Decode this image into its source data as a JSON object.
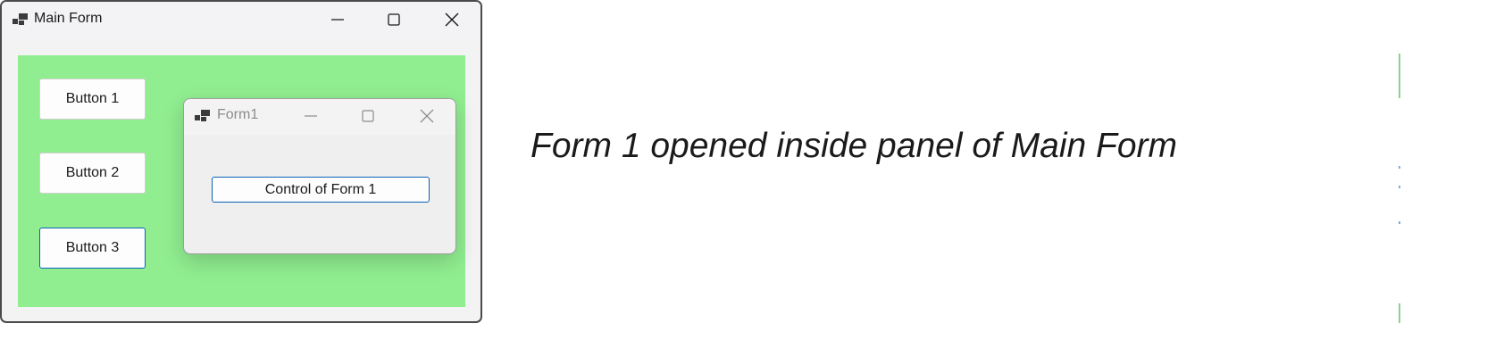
{
  "main_window": {
    "title": "Main Form",
    "icon": "app-window-icon",
    "controls": {
      "minimize_icon": "minimize-icon",
      "maximize_icon": "maximize-icon",
      "close_icon": "close-icon"
    }
  },
  "panel": {
    "background_color": "#90ee90",
    "buttons": [
      {
        "label": "Button 1",
        "focused": false
      },
      {
        "label": "Button 2",
        "focused": false
      },
      {
        "label": "Button 3",
        "focused": true
      }
    ]
  },
  "child_window": {
    "title": "Form1",
    "icon": "app-window-icon",
    "control_label": "Control of Form 1",
    "accent_color": "#0a63b8"
  },
  "caption": "Form 1 opened inside panel of Main Form"
}
